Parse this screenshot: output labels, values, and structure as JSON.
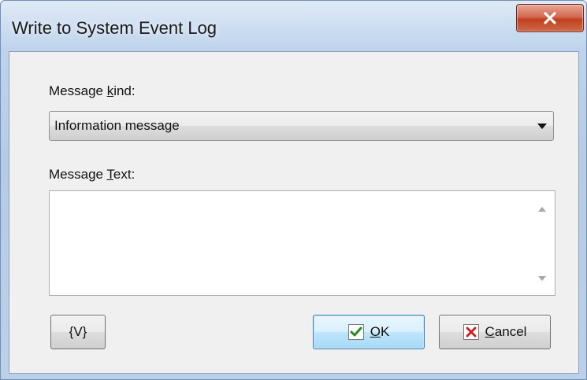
{
  "window": {
    "title": "Write to System Event Log"
  },
  "form": {
    "kind_label_pre": "Message ",
    "kind_label_accel": "k",
    "kind_label_post": "ind:",
    "kind_value": "Information message",
    "text_label_pre": "Message ",
    "text_label_accel": "T",
    "text_label_post": "ext:",
    "text_value": ""
  },
  "buttons": {
    "variables": "{V}",
    "ok_accel": "O",
    "ok_post": "K",
    "cancel_accel": "C",
    "cancel_post": "ancel"
  },
  "icons": {
    "close": "close-x-icon",
    "ok": "checkmark-icon",
    "cancel": "red-x-icon"
  },
  "colors": {
    "close_button": "#c7472b",
    "check": "#2a8a1c",
    "cancel_x": "#d11a1a"
  }
}
